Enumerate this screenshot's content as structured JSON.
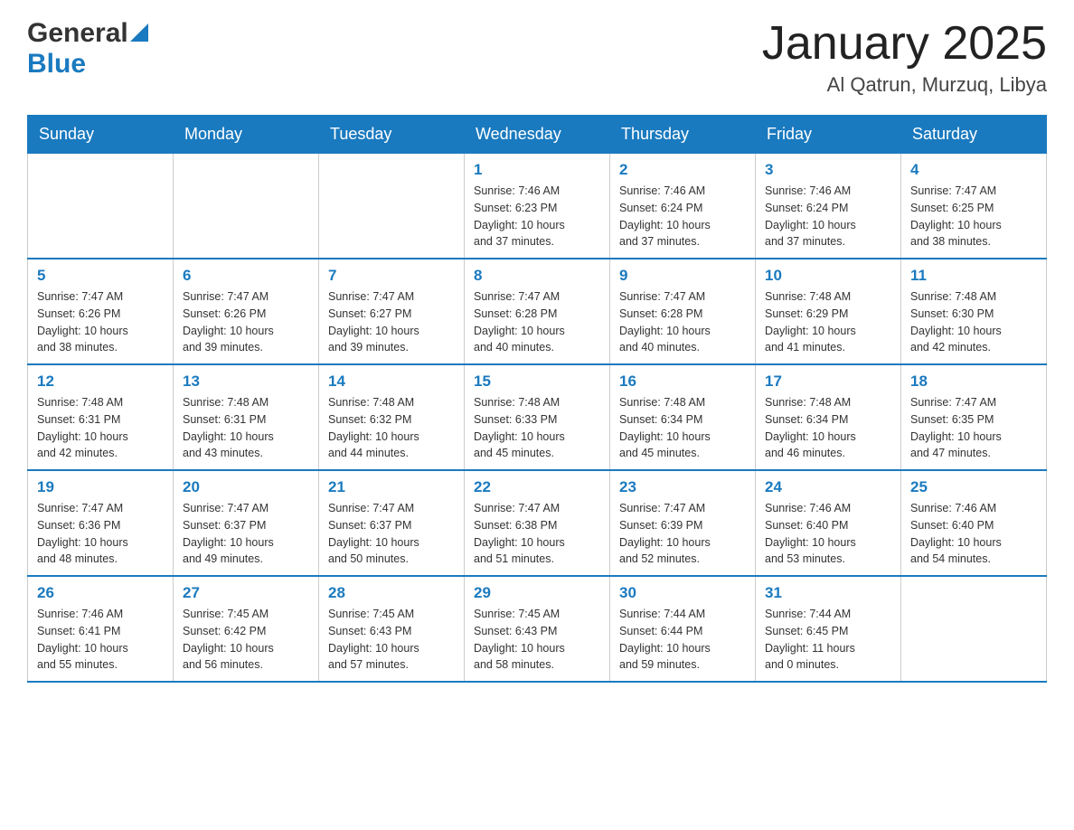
{
  "header": {
    "logo_general": "General",
    "logo_blue": "Blue",
    "month_title": "January 2025",
    "location": "Al Qatrun, Murzuq, Libya"
  },
  "days_of_week": [
    "Sunday",
    "Monday",
    "Tuesday",
    "Wednesday",
    "Thursday",
    "Friday",
    "Saturday"
  ],
  "weeks": [
    [
      {
        "day": "",
        "info": ""
      },
      {
        "day": "",
        "info": ""
      },
      {
        "day": "",
        "info": ""
      },
      {
        "day": "1",
        "sunrise": "7:46 AM",
        "sunset": "6:23 PM",
        "daylight": "10 hours and 37 minutes."
      },
      {
        "day": "2",
        "sunrise": "7:46 AM",
        "sunset": "6:24 PM",
        "daylight": "10 hours and 37 minutes."
      },
      {
        "day": "3",
        "sunrise": "7:46 AM",
        "sunset": "6:24 PM",
        "daylight": "10 hours and 37 minutes."
      },
      {
        "day": "4",
        "sunrise": "7:47 AM",
        "sunset": "6:25 PM",
        "daylight": "10 hours and 38 minutes."
      }
    ],
    [
      {
        "day": "5",
        "sunrise": "7:47 AM",
        "sunset": "6:26 PM",
        "daylight": "10 hours and 38 minutes."
      },
      {
        "day": "6",
        "sunrise": "7:47 AM",
        "sunset": "6:26 PM",
        "daylight": "10 hours and 39 minutes."
      },
      {
        "day": "7",
        "sunrise": "7:47 AM",
        "sunset": "6:27 PM",
        "daylight": "10 hours and 39 minutes."
      },
      {
        "day": "8",
        "sunrise": "7:47 AM",
        "sunset": "6:28 PM",
        "daylight": "10 hours and 40 minutes."
      },
      {
        "day": "9",
        "sunrise": "7:47 AM",
        "sunset": "6:28 PM",
        "daylight": "10 hours and 40 minutes."
      },
      {
        "day": "10",
        "sunrise": "7:48 AM",
        "sunset": "6:29 PM",
        "daylight": "10 hours and 41 minutes."
      },
      {
        "day": "11",
        "sunrise": "7:48 AM",
        "sunset": "6:30 PM",
        "daylight": "10 hours and 42 minutes."
      }
    ],
    [
      {
        "day": "12",
        "sunrise": "7:48 AM",
        "sunset": "6:31 PM",
        "daylight": "10 hours and 42 minutes."
      },
      {
        "day": "13",
        "sunrise": "7:48 AM",
        "sunset": "6:31 PM",
        "daylight": "10 hours and 43 minutes."
      },
      {
        "day": "14",
        "sunrise": "7:48 AM",
        "sunset": "6:32 PM",
        "daylight": "10 hours and 44 minutes."
      },
      {
        "day": "15",
        "sunrise": "7:48 AM",
        "sunset": "6:33 PM",
        "daylight": "10 hours and 45 minutes."
      },
      {
        "day": "16",
        "sunrise": "7:48 AM",
        "sunset": "6:34 PM",
        "daylight": "10 hours and 45 minutes."
      },
      {
        "day": "17",
        "sunrise": "7:48 AM",
        "sunset": "6:34 PM",
        "daylight": "10 hours and 46 minutes."
      },
      {
        "day": "18",
        "sunrise": "7:47 AM",
        "sunset": "6:35 PM",
        "daylight": "10 hours and 47 minutes."
      }
    ],
    [
      {
        "day": "19",
        "sunrise": "7:47 AM",
        "sunset": "6:36 PM",
        "daylight": "10 hours and 48 minutes."
      },
      {
        "day": "20",
        "sunrise": "7:47 AM",
        "sunset": "6:37 PM",
        "daylight": "10 hours and 49 minutes."
      },
      {
        "day": "21",
        "sunrise": "7:47 AM",
        "sunset": "6:37 PM",
        "daylight": "10 hours and 50 minutes."
      },
      {
        "day": "22",
        "sunrise": "7:47 AM",
        "sunset": "6:38 PM",
        "daylight": "10 hours and 51 minutes."
      },
      {
        "day": "23",
        "sunrise": "7:47 AM",
        "sunset": "6:39 PM",
        "daylight": "10 hours and 52 minutes."
      },
      {
        "day": "24",
        "sunrise": "7:46 AM",
        "sunset": "6:40 PM",
        "daylight": "10 hours and 53 minutes."
      },
      {
        "day": "25",
        "sunrise": "7:46 AM",
        "sunset": "6:40 PM",
        "daylight": "10 hours and 54 minutes."
      }
    ],
    [
      {
        "day": "26",
        "sunrise": "7:46 AM",
        "sunset": "6:41 PM",
        "daylight": "10 hours and 55 minutes."
      },
      {
        "day": "27",
        "sunrise": "7:45 AM",
        "sunset": "6:42 PM",
        "daylight": "10 hours and 56 minutes."
      },
      {
        "day": "28",
        "sunrise": "7:45 AM",
        "sunset": "6:43 PM",
        "daylight": "10 hours and 57 minutes."
      },
      {
        "day": "29",
        "sunrise": "7:45 AM",
        "sunset": "6:43 PM",
        "daylight": "10 hours and 58 minutes."
      },
      {
        "day": "30",
        "sunrise": "7:44 AM",
        "sunset": "6:44 PM",
        "daylight": "10 hours and 59 minutes."
      },
      {
        "day": "31",
        "sunrise": "7:44 AM",
        "sunset": "6:45 PM",
        "daylight": "11 hours and 0 minutes."
      },
      {
        "day": "",
        "info": ""
      }
    ]
  ],
  "labels": {
    "sunrise_prefix": "Sunrise: ",
    "sunset_prefix": "Sunset: ",
    "daylight_prefix": "Daylight: "
  }
}
